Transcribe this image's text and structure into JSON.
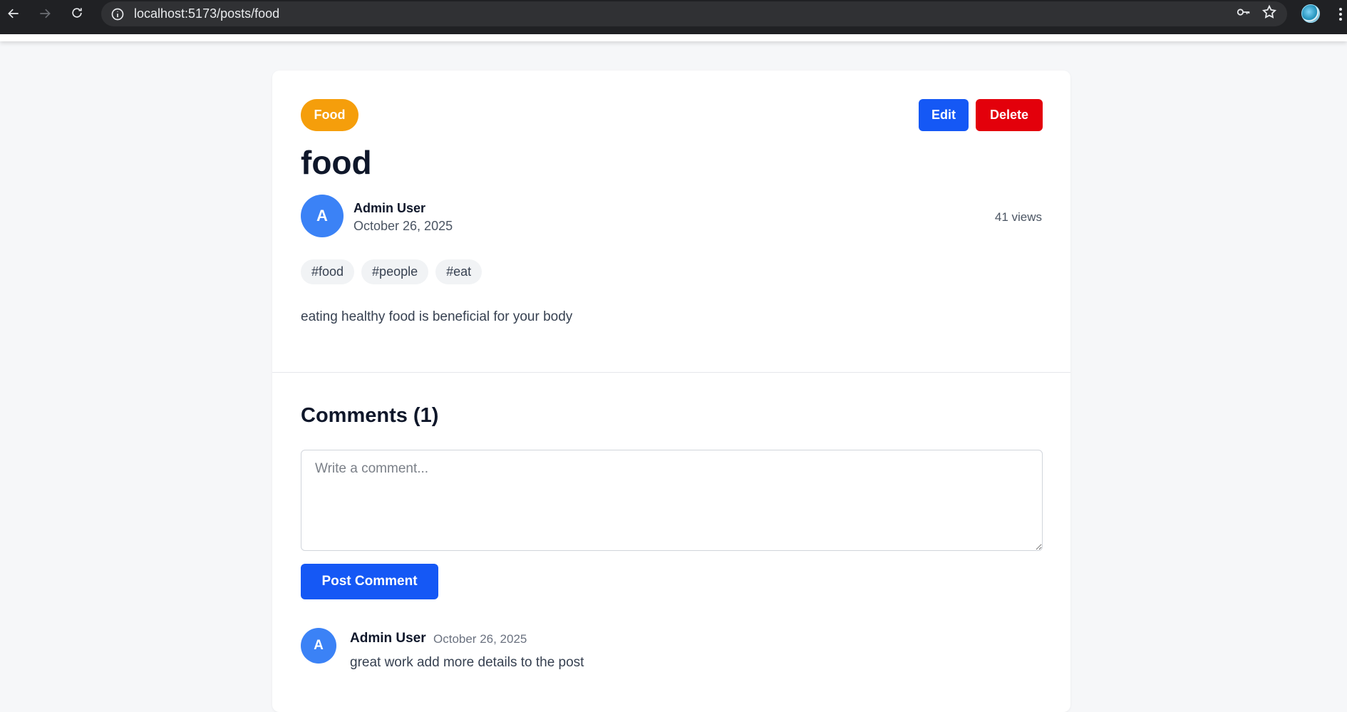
{
  "browser": {
    "url": "localhost:5173/posts/food",
    "icons": [
      "back-arrow-icon",
      "forward-arrow-icon",
      "reload-icon",
      "site-info-icon",
      "password-key-icon",
      "bookmark-star-icon",
      "profile-avatar",
      "more-menu-icon"
    ]
  },
  "post": {
    "category": "Food",
    "category_color": "#f59e0b",
    "edit_label": "Edit",
    "delete_label": "Delete",
    "title": "food",
    "author": {
      "initial": "A",
      "name": "Admin User"
    },
    "date": "October 26, 2025",
    "views": "41 views",
    "tags": [
      "#food",
      "#people",
      "#eat"
    ],
    "body": "eating healthy food is beneficial for your body"
  },
  "comments": {
    "heading": "Comments (1)",
    "input_placeholder": "Write a comment...",
    "submit_label": "Post Comment",
    "items": [
      {
        "initial": "A",
        "author": "Admin User",
        "date": "October 26, 2025",
        "text": "great work add more details to the post"
      }
    ]
  },
  "colors": {
    "primary": "#1558f5",
    "danger": "#e3000b",
    "avatar": "#3b82f6",
    "page_background": "#f6f7f9"
  }
}
